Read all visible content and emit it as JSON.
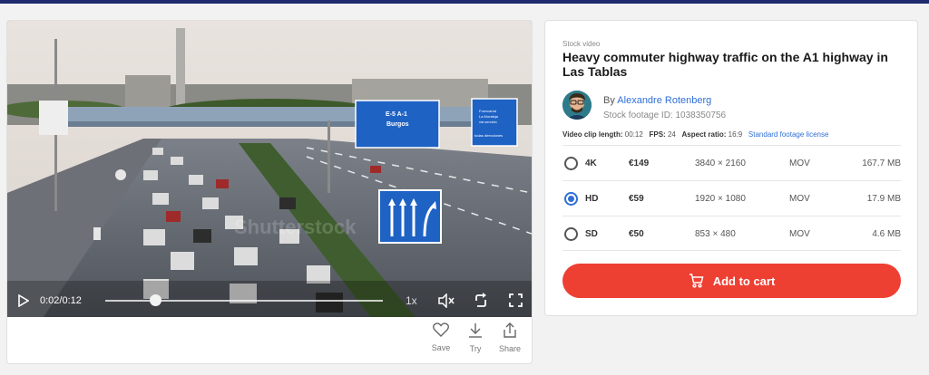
{
  "video": {
    "current_time": "0:02",
    "duration": "/0:12",
    "speed": "1x",
    "progress_fraction": 0.18,
    "watermark": "Shutterstock",
    "signs": {
      "top_sign_code": "E-5 A-1",
      "top_sign_city": "Burgos",
      "right_sign_line1": "Fuencarral",
      "right_sign_line2": "La Moraleja",
      "right_sign_line3": "via servicio",
      "right_sign_line4": "todas direcciones"
    }
  },
  "actions": [
    {
      "label": "Save",
      "icon": "heart-icon"
    },
    {
      "label": "Try",
      "icon": "download-icon"
    },
    {
      "label": "Share",
      "icon": "share-icon"
    }
  ],
  "info": {
    "kicker": "Stock video",
    "title": "Heavy commuter highway traffic on the A1 highway in Las Tablas",
    "by_prefix": "By",
    "author": "Alexandre Rotenberg",
    "stock_id": "Stock footage ID: 1038350756",
    "meta": {
      "length_label": "Video clip length:",
      "length_value": "00:12",
      "fps_label": "FPS:",
      "fps_value": "24",
      "aspect_label": "Aspect ratio:",
      "aspect_value": "16:9",
      "license_link": "Standard footage license"
    }
  },
  "options": [
    {
      "quality": "4K",
      "price": "€149",
      "resolution": "3840 × 2160",
      "format": "MOV",
      "size": "167.7 MB",
      "selected": false
    },
    {
      "quality": "HD",
      "price": "€59",
      "resolution": "1920 × 1080",
      "format": "MOV",
      "size": "17.9 MB",
      "selected": true
    },
    {
      "quality": "SD",
      "price": "€50",
      "resolution": "853 × 480",
      "format": "MOV",
      "size": "4.6 MB",
      "selected": false
    }
  ],
  "cart": {
    "label": "Add to cart"
  },
  "colors": {
    "accent": "#2f6fd6",
    "cart": "#ee3f33",
    "topbar": "#1f2a6e"
  }
}
